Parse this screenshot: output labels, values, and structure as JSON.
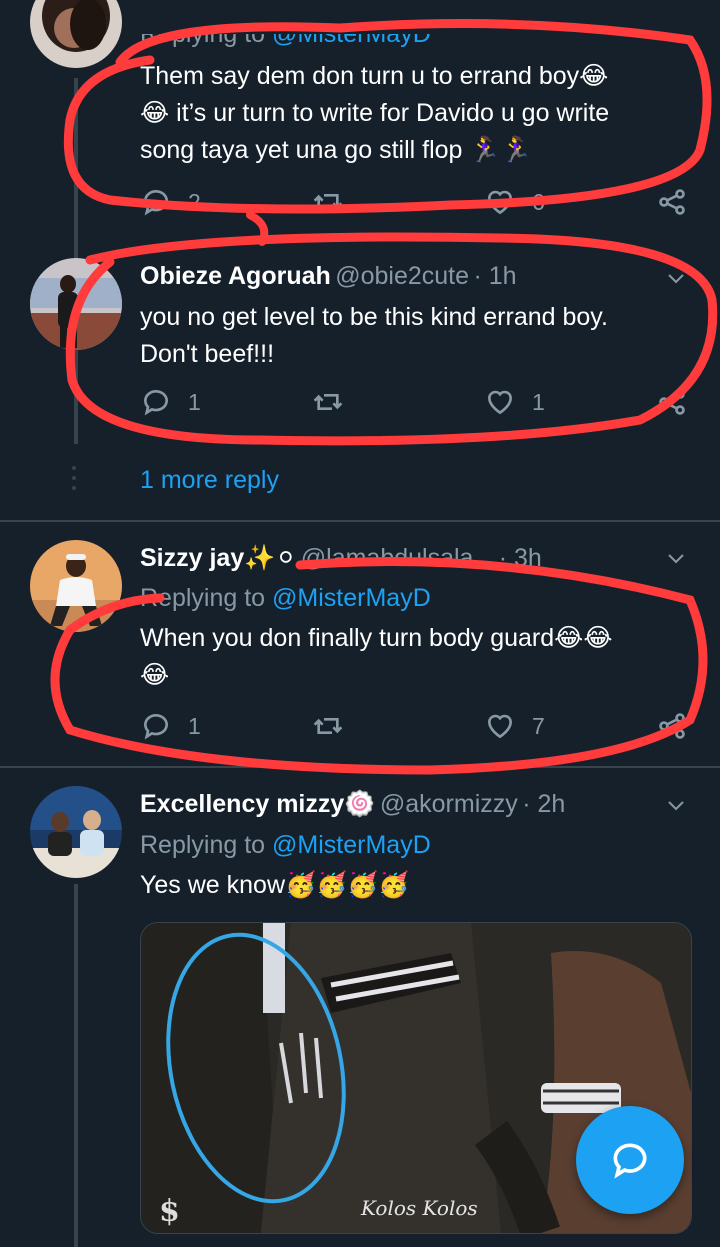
{
  "tweets": [
    {
      "reply_label": "Replying to",
      "reply_handle": "@MisterMayD",
      "text_lines": [
        "Them say dem don turn u to errand boy😂",
        "😂 it’s ur turn to write for Davido u go write",
        "song taya yet una go still flop 🏃‍♀️🏃‍♀️"
      ],
      "reply_count": "2",
      "like_count": "6"
    },
    {
      "name": "Obieze Agoruah",
      "handle": "@obie2cute",
      "time": "· 1h",
      "text_lines": [
        "you no get level to be this kind errand boy.",
        "Don't beef!!!"
      ],
      "reply_count": "1",
      "like_count": "1"
    },
    {
      "name": "Sizzy jay✨⚪",
      "handle": "@lamabdulsala...",
      "time": "· 3h",
      "reply_label": "Replying to",
      "reply_handle": "@MisterMayD",
      "text_lines": [
        "When you don finally turn body guard😂😂",
        "😂"
      ],
      "reply_count": "1",
      "like_count": "7"
    },
    {
      "name": "Excellency mizzy🍥",
      "handle": "@akormizzy",
      "time": "· 2h",
      "reply_label": "Replying to",
      "reply_handle": "@MisterMayD",
      "text": "Yes we know🥳🥳🥳🥳"
    }
  ],
  "more_replies": "1 more reply",
  "image_text": {
    "dollar": "$",
    "brand": "Kolos Kolos"
  },
  "colors": {
    "background": "#15202b",
    "accent": "#1da1f2",
    "secondary_text": "#8899a6",
    "divider": "#38444d",
    "annotation_red": "#ff3b3b",
    "annotation_blue": "#35a7e6"
  },
  "icons": [
    "reply-icon",
    "retweet-icon",
    "like-icon",
    "share-icon",
    "chevron-down-icon",
    "compose-icon"
  ]
}
